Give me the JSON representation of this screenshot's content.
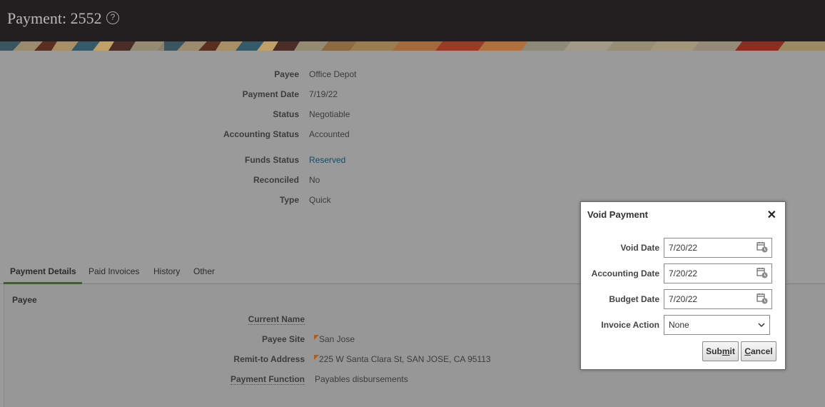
{
  "header": {
    "title": "Payment: 2552",
    "help_glyph": "?"
  },
  "summary": [
    {
      "label": "Payee",
      "value": "Office Depot"
    },
    {
      "label": "Payment Date",
      "value": "7/19/22"
    },
    {
      "label": "Status",
      "value": "Negotiable"
    },
    {
      "label": "Accounting Status",
      "value": "Accounted"
    },
    {
      "label": "Funds Status",
      "value": "Reserved"
    },
    {
      "label": "Reconciled",
      "value": "No"
    },
    {
      "label": "Type",
      "value": "Quick"
    }
  ],
  "tabs": [
    {
      "label": "Payment Details"
    },
    {
      "label": "Paid Invoices"
    },
    {
      "label": "History"
    },
    {
      "label": "Other"
    }
  ],
  "payee_section": {
    "title": "Payee",
    "fields": [
      {
        "label": "Current Name",
        "value": ""
      },
      {
        "label": "Payee Site",
        "value": "San Jose"
      },
      {
        "label": "Remit-to Address",
        "value": "225 W Santa Clara St, SAN JOSE, CA 95113"
      },
      {
        "label": "Payment Function",
        "value": "Payables disbursements"
      }
    ]
  },
  "dialog": {
    "title": "Void Payment",
    "close_glyph": "✕",
    "void_date": {
      "label": "Void Date",
      "value": "7/20/22"
    },
    "accounting_date": {
      "label": "Accounting Date",
      "value": "7/20/22"
    },
    "budget_date": {
      "label": "Budget Date",
      "value": "7/20/22"
    },
    "invoice_action": {
      "label": "Invoice Action",
      "value": "None"
    },
    "submit": {
      "pre": "Sub",
      "key": "m",
      "post": "it"
    },
    "cancel": {
      "key": "C",
      "post": "ancel"
    }
  },
  "colors": {
    "overlay": "#9a9a9a",
    "header_bg": "#231f20",
    "link": "#0c4f70",
    "active_tab_border": "#3e5f2b"
  },
  "icons": [
    "help-icon",
    "calendar-icon",
    "close-icon",
    "chevron-down-icon",
    "flag-icon"
  ]
}
